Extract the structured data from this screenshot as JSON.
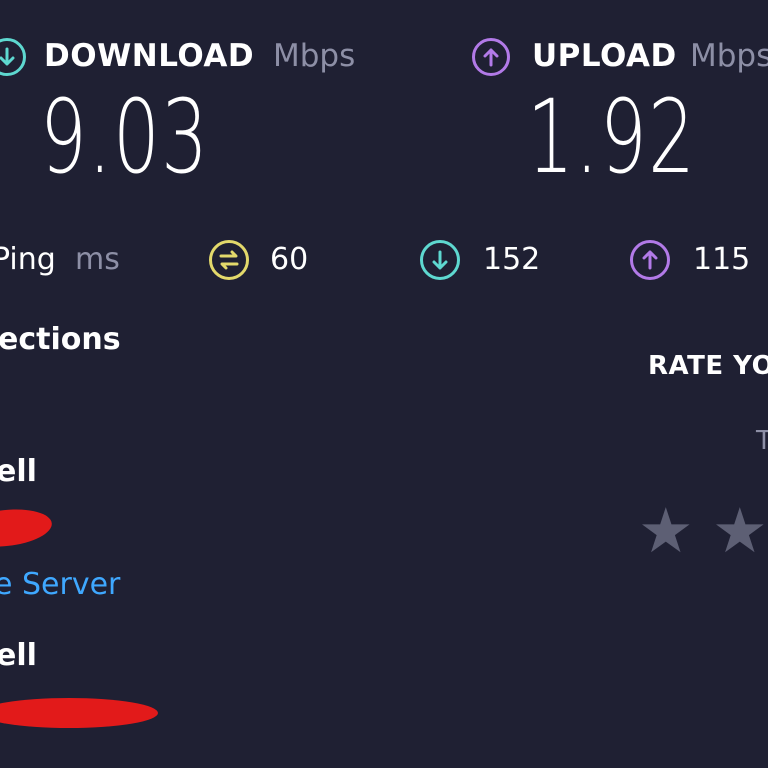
{
  "download": {
    "label": "DOWNLOAD",
    "unit": "Mbps",
    "value": "9.03",
    "icon": "arrow-down-circle-icon",
    "color": "#5ed8d0"
  },
  "upload": {
    "label": "UPLOAD",
    "unit": "Mbps",
    "value": "1.92",
    "icon": "arrow-up-circle-icon",
    "color": "#b27ae8"
  },
  "ping": {
    "label": "Ping",
    "unit": "ms",
    "idle": {
      "value": "60",
      "icon": "jitter-icon",
      "color": "#e3d96b"
    },
    "download": {
      "value": "152",
      "icon": "arrow-down-circle-icon",
      "color": "#5ed8d0"
    },
    "upload": {
      "value": "115",
      "icon": "arrow-up-circle-icon",
      "color": "#b27ae8"
    }
  },
  "connections": {
    "title": "ections",
    "isp_name": "ell",
    "change_server_label": "e Server",
    "server_name": "ell"
  },
  "rate": {
    "title": "RATE YO",
    "subtitle": "T",
    "stars": [
      "★",
      "★"
    ],
    "star_color": "#5d5f74"
  },
  "redaction_color": "#e21a1a"
}
